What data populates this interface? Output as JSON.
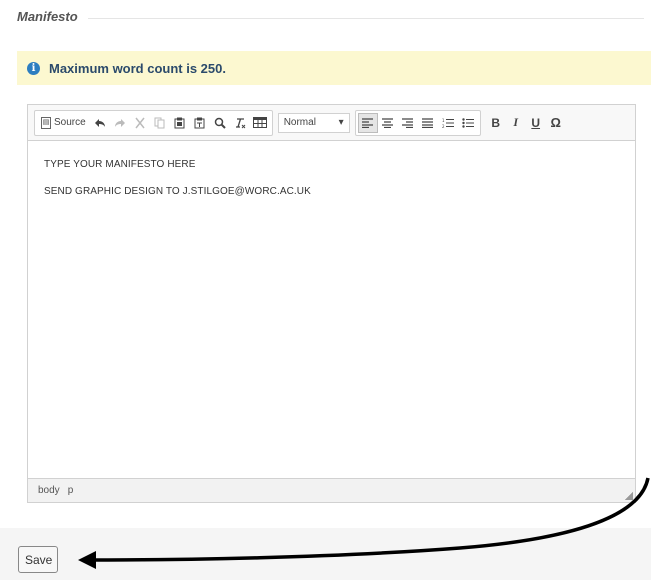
{
  "section": {
    "legend": "Manifesto"
  },
  "info": {
    "icon": "info-icon",
    "message": "Maximum word count is 250."
  },
  "toolbar": {
    "source_label": "Source",
    "format_value": "Normal",
    "icons": {
      "undo": "undo-icon",
      "redo": "redo-icon",
      "cut": "cut-icon",
      "copy": "copy-icon",
      "paste": "paste-icon",
      "paste_text": "paste-text-icon",
      "find": "search-icon",
      "remove_format": "remove-format-icon",
      "table": "table-icon",
      "align_left": "align-left-icon",
      "align_center": "align-center-icon",
      "align_right": "align-right-icon",
      "justify": "justify-icon",
      "numbered_list": "numbered-list-icon",
      "bulleted_list": "bulleted-list-icon",
      "bold": "B",
      "italic": "I",
      "underline": "U",
      "special_char": "Ω"
    }
  },
  "editor": {
    "lines": [
      "TYPE YOUR MANIFESTO HERE",
      "SEND GRAPHIC DESIGN TO J.STILGOE@WORC.AC.UK"
    ],
    "path": [
      "body",
      "p"
    ]
  },
  "actions": {
    "save_label": "Save"
  },
  "colors": {
    "info_bg": "#fcf8d0",
    "info_icon": "#2d7ec0",
    "arrow": "#000000"
  }
}
